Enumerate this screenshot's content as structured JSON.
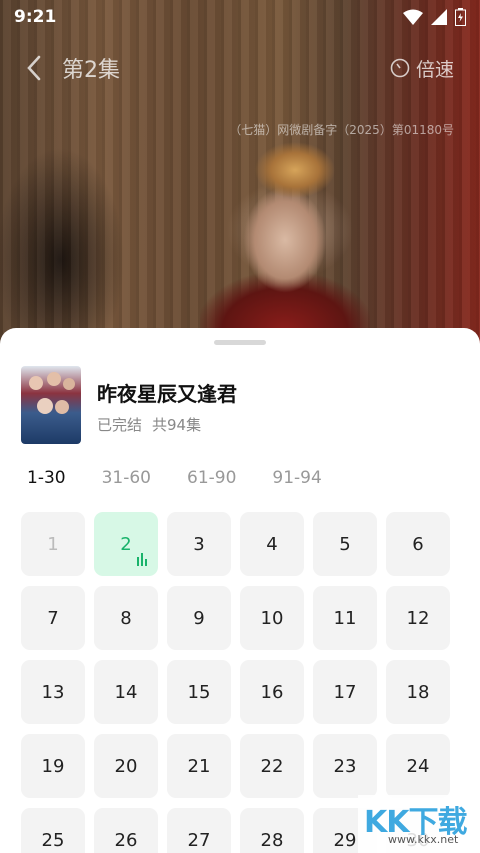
{
  "status_bar": {
    "time": "9:21"
  },
  "header": {
    "episode_title": "第2集",
    "speed_label": "倍速"
  },
  "video": {
    "registration": "（七猫）网微剧备字（2025）第01180号"
  },
  "drama": {
    "title": "昨夜星辰又逢君",
    "status": "已完结",
    "count": "共94集"
  },
  "tabs": [
    "1-30",
    "31-60",
    "61-90",
    "91-94"
  ],
  "episodes": [
    "1",
    "2",
    "3",
    "4",
    "5",
    "6",
    "7",
    "8",
    "9",
    "10",
    "11",
    "12",
    "13",
    "14",
    "15",
    "16",
    "17",
    "18",
    "19",
    "20",
    "21",
    "22",
    "23",
    "24",
    "25",
    "26",
    "27",
    "28",
    "29",
    "30"
  ],
  "watermark": {
    "main": "KK下载",
    "url": "www.kkx.net"
  },
  "colors": {
    "accent": "#19b36b",
    "current_bg": "#d7f8e6"
  }
}
